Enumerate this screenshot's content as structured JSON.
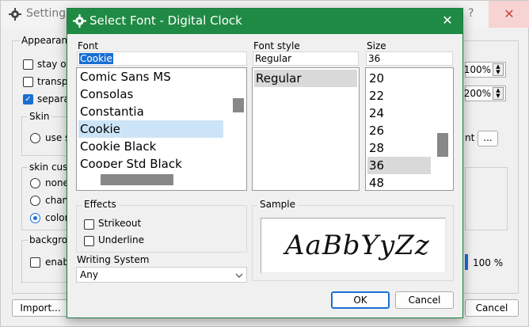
{
  "settings": {
    "title": "Settings",
    "help_label": "?",
    "close_label": "✕",
    "appearance_label": "Appearance",
    "checkboxes": [
      {
        "label": "stay on",
        "checked": false
      },
      {
        "label": "transpa",
        "checked": false
      },
      {
        "label": "separa",
        "checked": true
      }
    ],
    "skin_label": "Skin",
    "skin_option": "use s",
    "skin_custom_label": "skin cus",
    "skin_radios": [
      {
        "label": "none",
        "checked": false
      },
      {
        "label": "chan",
        "checked": false
      },
      {
        "label": "color",
        "checked": true
      }
    ],
    "background_label": "backgro",
    "enable_label": "enab",
    "opacity_value": "100%",
    "scale_value": "200%",
    "nt_fragment": "nt",
    "browse_label": "...",
    "zoom_value": "100 %",
    "import_label": "Import...",
    "cancel_label": "Cancel"
  },
  "dialog": {
    "title": "Select Font - Digital Clock",
    "close_label": "✕",
    "font_caption": "Font",
    "font_value": "Cookie",
    "font_list": [
      "Comic Sans MS",
      "Consolas",
      "Constantia",
      "Cookie",
      "Cookie Black",
      "Cooper Std Black"
    ],
    "font_selected_index": 3,
    "style_caption": "Font style",
    "style_value": "Regular",
    "style_list": [
      "Regular"
    ],
    "size_caption": "Size",
    "size_value": "36",
    "size_list": [
      "20",
      "22",
      "24",
      "26",
      "28",
      "36",
      "48"
    ],
    "size_selected_index": 5,
    "effects_label": "Effects",
    "strikeout_label": "Strikeout",
    "underline_label": "Underline",
    "sample_label": "Sample",
    "sample_text": "AaBbYyZz",
    "writing_system_label": "Writing System",
    "writing_system_value": "Any",
    "ok_label": "OK",
    "cancel_label": "Cancel"
  },
  "colors": {
    "titlebar_green": "#1f8a44",
    "selection_blue": "#1a6fd1",
    "list_highlight": "#cce4f7"
  }
}
